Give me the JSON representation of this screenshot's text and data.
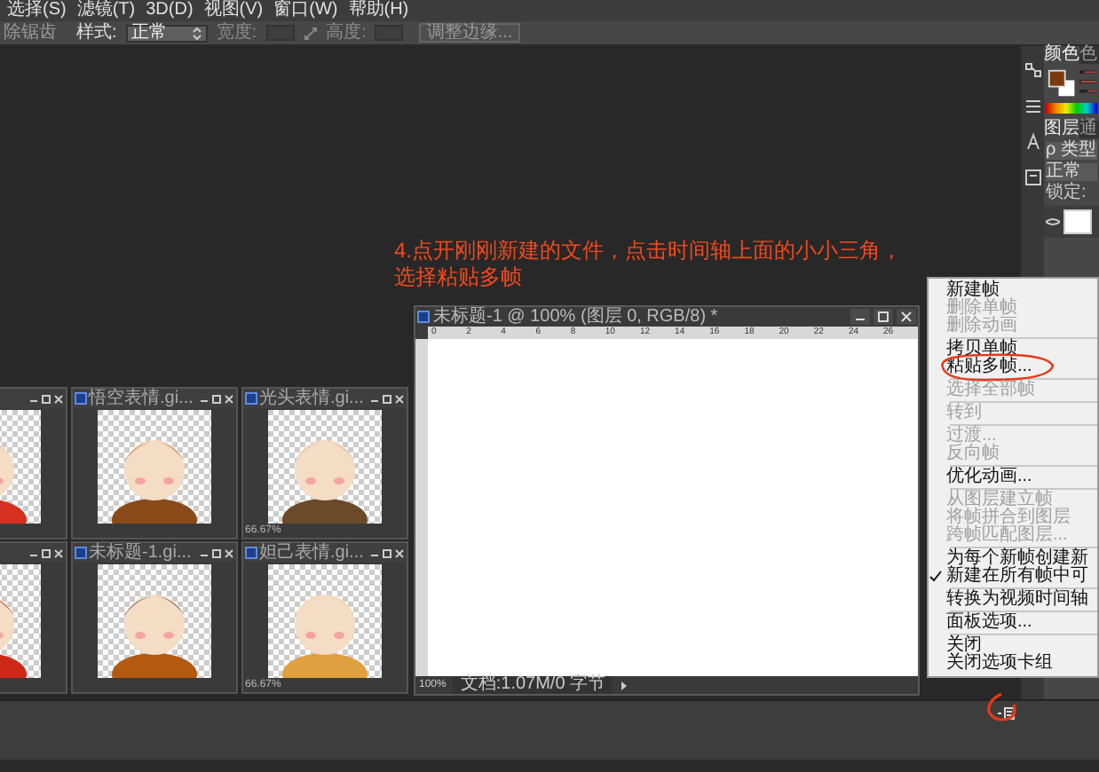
{
  "menu_bar": [
    "选择(S)",
    "滤镜(T)",
    "3D(D)",
    "视图(V)",
    "窗口(W)",
    "帮助(H)"
  ],
  "options_bar": {
    "cut_label": "除锯齿",
    "style_label": "样式:",
    "style_value": "正常",
    "width_label": "宽度:",
    "height_label": "高度:",
    "refine_button": "调整边缘..."
  },
  "annotation": "4.点开刚刚新建的文件，点击时间轴上面的小小三角，选择粘贴多帧",
  "thumbnails": [
    {
      "kind": "picture"
    },
    {
      "kind": "picture",
      "title": "悟空表情.gi..."
    },
    {
      "kind": "picture",
      "title": "光头表情.gi...",
      "zoom": "66.67%"
    },
    {
      "kind": "picture"
    },
    {
      "kind": "picture",
      "title": "未标题-1.gi..."
    },
    {
      "kind": "picture",
      "title": "妲己表情.gi...",
      "zoom": "66.67%"
    }
  ],
  "document": {
    "title": "未标题-1 @ 100% (图层 0, RGB/8) *",
    "ruler": [
      "0",
      "2",
      "4",
      "6",
      "8",
      "10",
      "12",
      "14",
      "16",
      "18",
      "20",
      "22",
      "24",
      "26"
    ],
    "zoom": "100%",
    "doc_info": "文档:1.07M/0 字节"
  },
  "right_panel": {
    "color_tabs": [
      "颜色",
      "色"
    ],
    "layer_tabs": [
      "图层",
      "通"
    ],
    "filter": "ρ 类型",
    "blend": "正常",
    "lock": "锁定:"
  },
  "context_menu": [
    [
      {
        "label": "新建帧",
        "disabled": false,
        "checked": false,
        "circled": false
      },
      {
        "label": "删除单帧",
        "disabled": true,
        "checked": false,
        "circled": false
      },
      {
        "label": "删除动画",
        "disabled": true,
        "checked": false,
        "circled": false
      }
    ],
    [
      {
        "label": "拷贝单帧",
        "disabled": false,
        "checked": false,
        "circled": false
      },
      {
        "label": "粘贴多帧...",
        "disabled": false,
        "checked": false,
        "circled": true
      }
    ],
    [
      {
        "label": "选择全部帧",
        "disabled": true,
        "checked": false,
        "circled": false
      }
    ],
    [
      {
        "label": "转到",
        "disabled": true,
        "checked": false,
        "circled": false
      }
    ],
    [
      {
        "label": "过渡...",
        "disabled": true,
        "checked": false,
        "circled": false
      },
      {
        "label": "反向帧",
        "disabled": true,
        "checked": false,
        "circled": false
      }
    ],
    [
      {
        "label": "优化动画...",
        "disabled": false,
        "checked": false,
        "circled": false
      }
    ],
    [
      {
        "label": "从图层建立帧",
        "disabled": true,
        "checked": false,
        "circled": false
      },
      {
        "label": "将帧拼合到图层",
        "disabled": true,
        "checked": false,
        "circled": false
      },
      {
        "label": "跨帧匹配图层...",
        "disabled": true,
        "checked": false,
        "circled": false
      }
    ],
    [
      {
        "label": "为每个新帧创建新",
        "disabled": false,
        "checked": false,
        "circled": false
      },
      {
        "label": "新建在所有帧中可",
        "disabled": false,
        "checked": true,
        "circled": false
      }
    ],
    [
      {
        "label": "转换为视频时间轴",
        "disabled": false,
        "checked": false,
        "circled": false
      }
    ],
    [
      {
        "label": "面板选项...",
        "disabled": false,
        "checked": false,
        "circled": false
      }
    ],
    [
      {
        "label": "关闭",
        "disabled": false,
        "checked": false,
        "circled": false
      },
      {
        "label": "关闭选项卡组",
        "disabled": false,
        "checked": false,
        "circled": false
      }
    ]
  ],
  "timeline": {
    "menu_circled": true
  }
}
